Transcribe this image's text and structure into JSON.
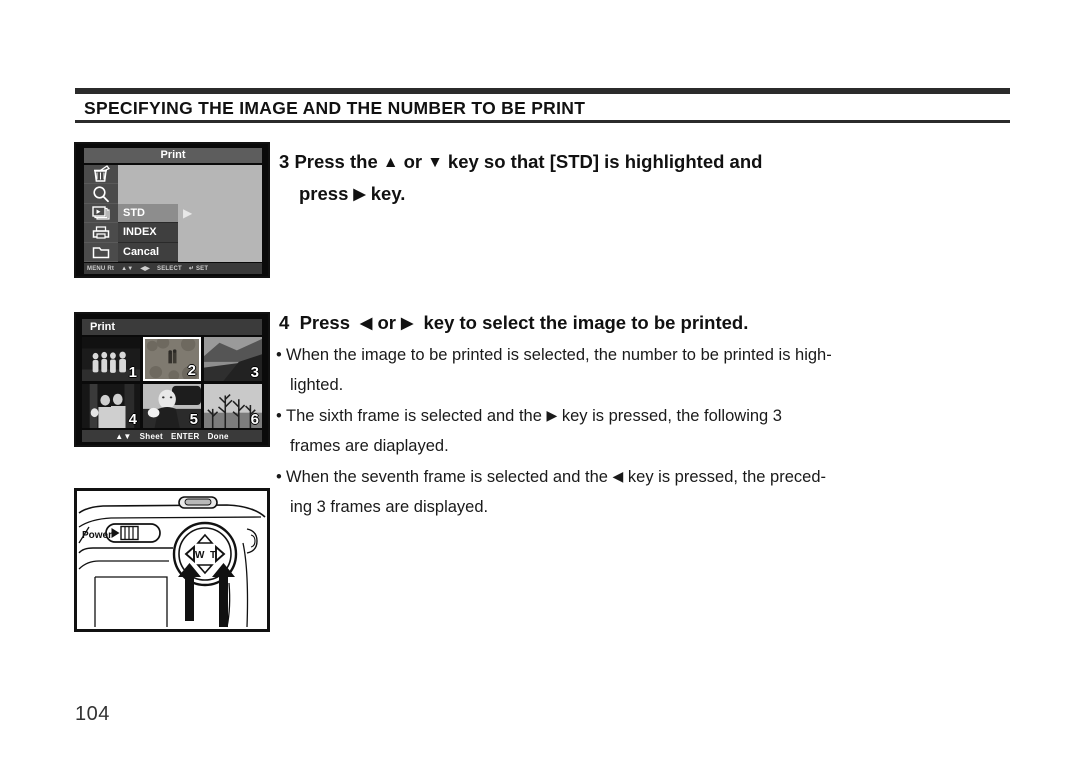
{
  "page": {
    "title": "SPECIFYING THE IMAGE AND THE NUMBER TO BE PRINT",
    "number": "104"
  },
  "lcd_print_menu": {
    "title": "Print",
    "icons": [
      "trash-icon",
      "magnifier-icon",
      "slideshow-icon",
      "printer-icon",
      "folder-icon"
    ],
    "menu_items": [
      {
        "label": "STD",
        "selected": true
      },
      {
        "label": "INDEX",
        "selected": false
      },
      {
        "label": "Cancal",
        "selected": false
      }
    ],
    "cursor_arrow": "▶",
    "status_bar": [
      "MENU Rt",
      "▲▼",
      "◀▶",
      "SELECT",
      "↵ SET"
    ]
  },
  "lcd_thumb_index": {
    "title": "Print",
    "thumbnails": [
      {
        "number": "1",
        "selected": false
      },
      {
        "number": "2",
        "selected": true
      },
      {
        "number": "3",
        "selected": false
      },
      {
        "number": "4",
        "selected": false
      },
      {
        "number": "5",
        "selected": false
      },
      {
        "number": "6",
        "selected": false
      }
    ],
    "status_bar": {
      "keys": "▲▼",
      "sheet_label": "Sheet",
      "enter_label": "ENTER",
      "done_label": "Done"
    }
  },
  "camera": {
    "power_label": "Power",
    "wide_label": "W",
    "tele_label": "T"
  },
  "steps": {
    "step3": {
      "number": "3",
      "line1_a": "Press the",
      "up_arrow": "▲",
      "or": "or",
      "down_arrow": "▼",
      "line1_b": "key so that [STD] is highlighted and",
      "line2_a": "press",
      "right_arrow": "▶",
      "line2_b": "key."
    },
    "step4": {
      "number": "4",
      "text_a": "Press",
      "left_arrow": "◀",
      "or": "or",
      "right_arrow": "▶",
      "text_b": "key to select the image to be printed."
    }
  },
  "bullets": [
    {
      "marker": "•",
      "text_a": "When the image to be printed is selected, the number to be printed is high-",
      "arrow": "",
      "text_b": "",
      "cont": "lighted."
    },
    {
      "marker": "•",
      "text_a": "The sixth frame is selected and the",
      "arrow": "▶",
      "text_b": "key is pressed, the following 3",
      "cont": "frames are diaplayed."
    },
    {
      "marker": "•",
      "text_a": "When the seventh frame is selected  and the",
      "arrow": "◀",
      "text_b": "key is pressed, the preced-",
      "cont": "ing 3 frames are displayed."
    }
  ]
}
